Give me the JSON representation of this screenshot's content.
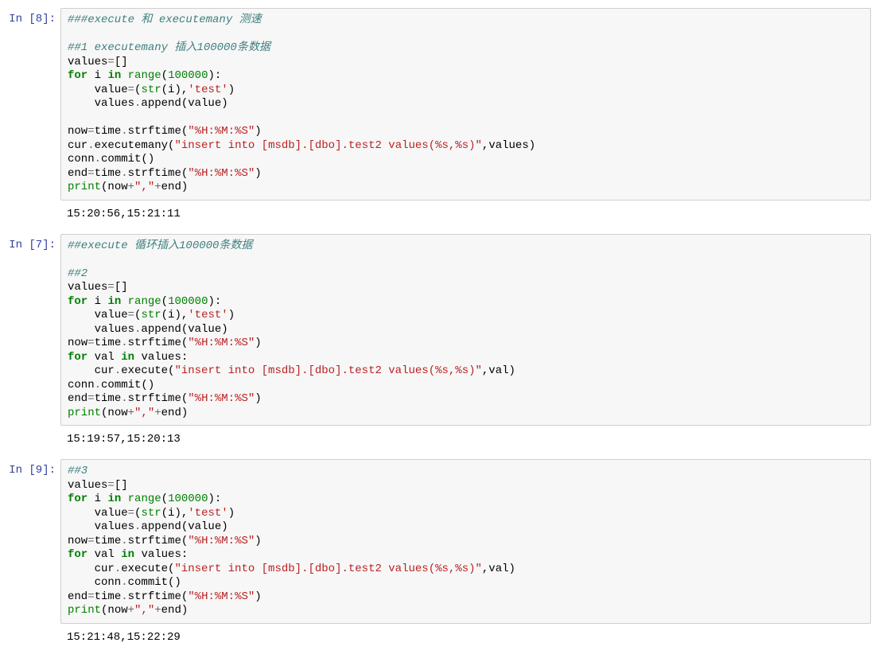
{
  "cells": [
    {
      "prompt": "In [8]:",
      "code_tokens": [
        [
          [
            "###execute 和 executemany 测速",
            "c-comment"
          ]
        ],
        [],
        [
          [
            "##1 executemany 插入100000条数据",
            "c-comment"
          ]
        ],
        [
          [
            "values",
            ""
          ],
          [
            "=",
            "c-op"
          ],
          [
            "[]",
            ""
          ]
        ],
        [
          [
            "for",
            "c-keyword"
          ],
          [
            " i ",
            ""
          ],
          [
            "in",
            "c-keyword"
          ],
          [
            " ",
            ""
          ],
          [
            "range",
            "c-builtin"
          ],
          [
            "(",
            ""
          ],
          [
            "100000",
            "c-num"
          ],
          [
            "):",
            ""
          ]
        ],
        [
          [
            "    value",
            ""
          ],
          [
            "=",
            "c-op"
          ],
          [
            "(",
            ""
          ],
          [
            "str",
            "c-builtin"
          ],
          [
            "(i),",
            ""
          ],
          [
            "'test'",
            "c-string"
          ],
          [
            ")",
            ""
          ]
        ],
        [
          [
            "    values",
            ""
          ],
          [
            ".",
            "c-op"
          ],
          [
            "append(value)",
            ""
          ]
        ],
        [],
        [
          [
            "now",
            ""
          ],
          [
            "=",
            "c-op"
          ],
          [
            "time",
            ""
          ],
          [
            ".",
            "c-op"
          ],
          [
            "strftime(",
            ""
          ],
          [
            "\"%H:%M:%S\"",
            "c-string"
          ],
          [
            ")",
            ""
          ]
        ],
        [
          [
            "cur",
            ""
          ],
          [
            ".",
            "c-op"
          ],
          [
            "executemany(",
            ""
          ],
          [
            "\"insert into [msdb].[dbo].test2 values(%s,%s)\"",
            "c-string"
          ],
          [
            ",values)",
            ""
          ]
        ],
        [
          [
            "conn",
            ""
          ],
          [
            ".",
            "c-op"
          ],
          [
            "commit()",
            ""
          ]
        ],
        [
          [
            "end",
            ""
          ],
          [
            "=",
            "c-op"
          ],
          [
            "time",
            ""
          ],
          [
            ".",
            "c-op"
          ],
          [
            "strftime(",
            ""
          ],
          [
            "\"%H:%M:%S\"",
            "c-string"
          ],
          [
            ")",
            ""
          ]
        ],
        [
          [
            "print",
            "c-func"
          ],
          [
            "(now",
            ""
          ],
          [
            "+",
            "c-op"
          ],
          [
            "\",\"",
            "c-string"
          ],
          [
            "+",
            "c-op"
          ],
          [
            "end)",
            ""
          ]
        ]
      ],
      "output": "15:20:56,15:21:11"
    },
    {
      "prompt": "In [7]:",
      "code_tokens": [
        [
          [
            "##execute 循环插入100000条数据",
            "c-comment"
          ]
        ],
        [],
        [
          [
            "##2",
            "c-comment"
          ]
        ],
        [
          [
            "values",
            ""
          ],
          [
            "=",
            "c-op"
          ],
          [
            "[]",
            ""
          ]
        ],
        [
          [
            "for",
            "c-keyword"
          ],
          [
            " i ",
            ""
          ],
          [
            "in",
            "c-keyword"
          ],
          [
            " ",
            ""
          ],
          [
            "range",
            "c-builtin"
          ],
          [
            "(",
            ""
          ],
          [
            "100000",
            "c-num"
          ],
          [
            "):",
            ""
          ]
        ],
        [
          [
            "    value",
            ""
          ],
          [
            "=",
            "c-op"
          ],
          [
            "(",
            ""
          ],
          [
            "str",
            "c-builtin"
          ],
          [
            "(i),",
            ""
          ],
          [
            "'test'",
            "c-string"
          ],
          [
            ")",
            ""
          ]
        ],
        [
          [
            "    values",
            ""
          ],
          [
            ".",
            "c-op"
          ],
          [
            "append(value)",
            ""
          ]
        ],
        [
          [
            "now",
            ""
          ],
          [
            "=",
            "c-op"
          ],
          [
            "time",
            ""
          ],
          [
            ".",
            "c-op"
          ],
          [
            "strftime(",
            ""
          ],
          [
            "\"%H:%M:%S\"",
            "c-string"
          ],
          [
            ")",
            ""
          ]
        ],
        [
          [
            "for",
            "c-keyword"
          ],
          [
            " val ",
            ""
          ],
          [
            "in",
            "c-keyword"
          ],
          [
            " values:",
            ""
          ]
        ],
        [
          [
            "    cur",
            ""
          ],
          [
            ".",
            "c-op"
          ],
          [
            "execute(",
            ""
          ],
          [
            "\"insert into [msdb].[dbo].test2 values(%s,%s)\"",
            "c-string"
          ],
          [
            ",val)",
            ""
          ]
        ],
        [
          [
            "conn",
            ""
          ],
          [
            ".",
            "c-op"
          ],
          [
            "commit()",
            ""
          ]
        ],
        [
          [
            "end",
            ""
          ],
          [
            "=",
            "c-op"
          ],
          [
            "time",
            ""
          ],
          [
            ".",
            "c-op"
          ],
          [
            "strftime(",
            ""
          ],
          [
            "\"%H:%M:%S\"",
            "c-string"
          ],
          [
            ")",
            ""
          ]
        ],
        [
          [
            "print",
            "c-func"
          ],
          [
            "(now",
            ""
          ],
          [
            "+",
            "c-op"
          ],
          [
            "\",\"",
            "c-string"
          ],
          [
            "+",
            "c-op"
          ],
          [
            "end)",
            ""
          ]
        ]
      ],
      "output": "15:19:57,15:20:13"
    },
    {
      "prompt": "In [9]:",
      "code_tokens": [
        [
          [
            "##3",
            "c-comment"
          ]
        ],
        [
          [
            "values",
            ""
          ],
          [
            "=",
            "c-op"
          ],
          [
            "[]",
            ""
          ]
        ],
        [
          [
            "for",
            "c-keyword"
          ],
          [
            " i ",
            ""
          ],
          [
            "in",
            "c-keyword"
          ],
          [
            " ",
            ""
          ],
          [
            "range",
            "c-builtin"
          ],
          [
            "(",
            ""
          ],
          [
            "100000",
            "c-num"
          ],
          [
            "):",
            ""
          ]
        ],
        [
          [
            "    value",
            ""
          ],
          [
            "=",
            "c-op"
          ],
          [
            "(",
            ""
          ],
          [
            "str",
            "c-builtin"
          ],
          [
            "(i),",
            ""
          ],
          [
            "'test'",
            "c-string"
          ],
          [
            ")",
            ""
          ]
        ],
        [
          [
            "    values",
            ""
          ],
          [
            ".",
            "c-op"
          ],
          [
            "append(value)",
            ""
          ]
        ],
        [
          [
            "now",
            ""
          ],
          [
            "=",
            "c-op"
          ],
          [
            "time",
            ""
          ],
          [
            ".",
            "c-op"
          ],
          [
            "strftime(",
            ""
          ],
          [
            "\"%H:%M:%S\"",
            "c-string"
          ],
          [
            ")",
            ""
          ]
        ],
        [
          [
            "for",
            "c-keyword"
          ],
          [
            " val ",
            ""
          ],
          [
            "in",
            "c-keyword"
          ],
          [
            " values:",
            ""
          ]
        ],
        [
          [
            "    cur",
            ""
          ],
          [
            ".",
            "c-op"
          ],
          [
            "execute(",
            ""
          ],
          [
            "\"insert into [msdb].[dbo].test2 values(%s,%s)\"",
            "c-string"
          ],
          [
            ",val)",
            ""
          ]
        ],
        [
          [
            "    conn",
            ""
          ],
          [
            ".",
            "c-op"
          ],
          [
            "commit()",
            ""
          ]
        ],
        [
          [
            "end",
            ""
          ],
          [
            "=",
            "c-op"
          ],
          [
            "time",
            ""
          ],
          [
            ".",
            "c-op"
          ],
          [
            "strftime(",
            ""
          ],
          [
            "\"%H:%M:%S\"",
            "c-string"
          ],
          [
            ")",
            ""
          ]
        ],
        [
          [
            "print",
            "c-func"
          ],
          [
            "(now",
            ""
          ],
          [
            "+",
            "c-op"
          ],
          [
            "\",\"",
            "c-string"
          ],
          [
            "+",
            "c-op"
          ],
          [
            "end)",
            ""
          ]
        ]
      ],
      "output": "15:21:48,15:22:29"
    }
  ]
}
